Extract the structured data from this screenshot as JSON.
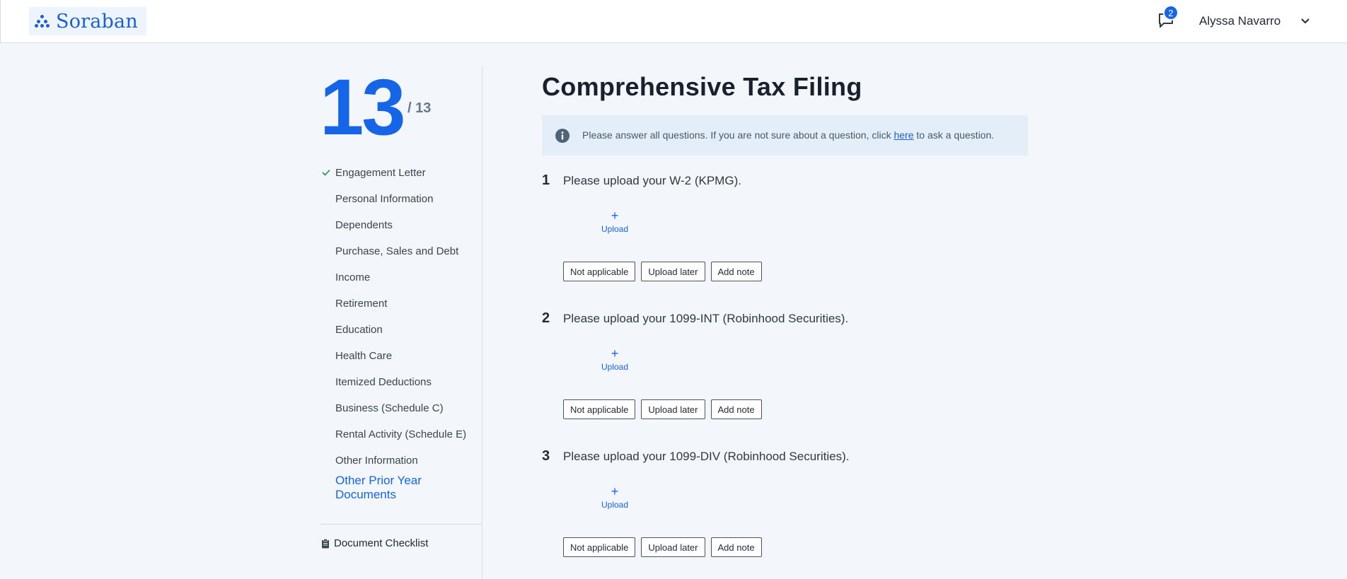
{
  "header": {
    "logo_text": "Soraban",
    "message_badge_count": "2",
    "user_name": "Alyssa Navarro"
  },
  "progress": {
    "current": "13",
    "total": "/ 13"
  },
  "sidebar": {
    "items": [
      {
        "label": "Engagement Letter",
        "completed": true
      },
      {
        "label": "Personal Information"
      },
      {
        "label": "Dependents"
      },
      {
        "label": "Purchase, Sales and Debt"
      },
      {
        "label": "Income"
      },
      {
        "label": "Retirement"
      },
      {
        "label": "Education"
      },
      {
        "label": "Health Care"
      },
      {
        "label": "Itemized Deductions"
      },
      {
        "label": "Business (Schedule C)"
      },
      {
        "label": "Rental Activity (Schedule E)"
      },
      {
        "label": "Other Information"
      },
      {
        "label": "Other Prior Year Documents",
        "active": true
      }
    ],
    "document_checklist_label": "Document Checklist"
  },
  "main": {
    "title": "Comprehensive Tax Filing",
    "info": {
      "text_before": "Please answer all questions. If you are not sure about a question, click ",
      "link": "here",
      "text_after": " to ask a question."
    },
    "questions": [
      {
        "number": "1",
        "text": "Please upload your W-2 (KPMG).",
        "upload_label": "Upload",
        "upload_symbol": "+",
        "actions": [
          "Not applicable",
          "Upload later",
          "Add note"
        ]
      },
      {
        "number": "2",
        "text": "Please upload your 1099-INT (Robinhood Securities).",
        "upload_label": "Upload",
        "upload_symbol": "+",
        "actions": [
          "Not applicable",
          "Upload later",
          "Add note"
        ]
      },
      {
        "number": "3",
        "text": "Please upload your 1099-DIV (Robinhood Securities).",
        "upload_label": "Upload",
        "upload_symbol": "+",
        "actions": [
          "Not applicable",
          "Upload later",
          "Add note"
        ]
      }
    ]
  },
  "colors": {
    "accent": "#1565e8",
    "background": "#f3f6fa",
    "info_background": "#e3eef9",
    "check": "#2e8b57"
  }
}
